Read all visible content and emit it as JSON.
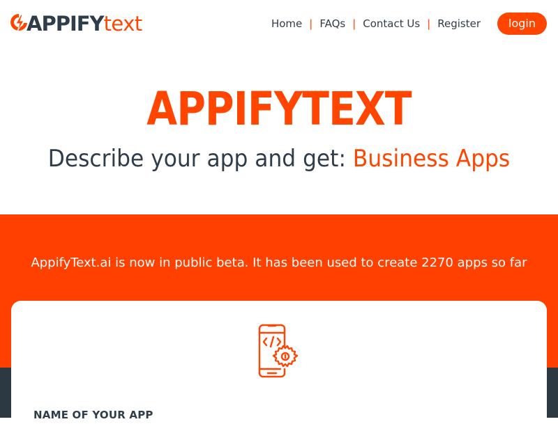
{
  "header": {
    "logo": {
      "part1": "APPIFY",
      "part2": "text"
    },
    "nav": [
      {
        "label": "Home"
      },
      {
        "label": "FAQs"
      },
      {
        "label": "Contact Us"
      },
      {
        "label": "Register"
      }
    ],
    "login_label": "login"
  },
  "hero": {
    "title": "APPIFYTEXT",
    "subtitle_prefix": "Describe your app and get: ",
    "subtitle_accent": "Business Apps"
  },
  "banner": {
    "text": "AppifyText.ai is now in public beta. It has been used to create 2270 apps so far"
  },
  "form": {
    "icon": "mobile-code-gear-icon",
    "name_label": "NAME OF YOUR APP"
  },
  "colors": {
    "accent": "#ff4500",
    "dark": "#2f3d4a",
    "band": "#ff4000",
    "footer_band": "#2d3942"
  }
}
